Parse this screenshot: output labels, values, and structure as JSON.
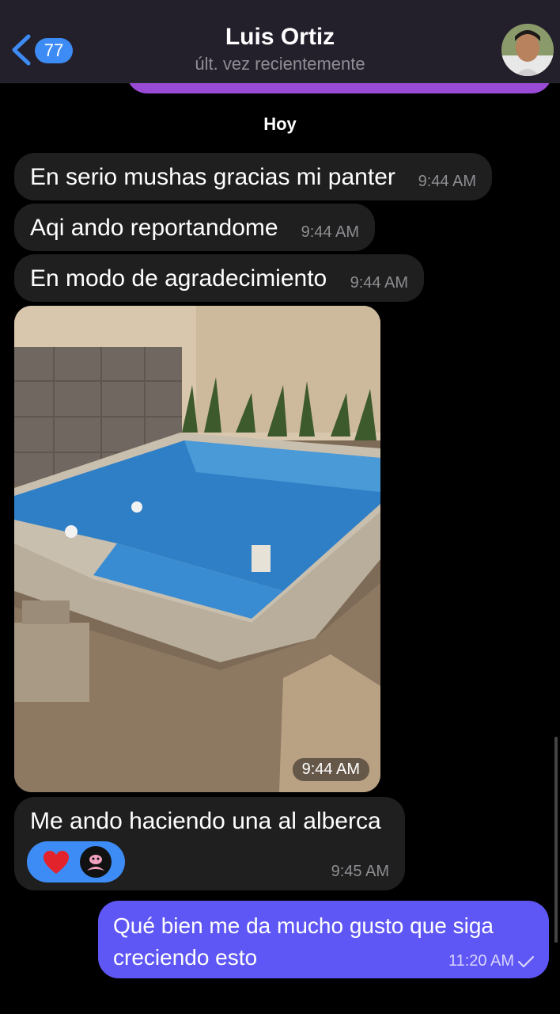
{
  "header": {
    "back_count": "77",
    "contact_name": "Luis Ortiz",
    "status": "últ. vez recientemente"
  },
  "chat": {
    "day_label": "Hoy",
    "messages": [
      {
        "text": "En serio mushas gracias mi panter",
        "time": "9:44 AM"
      },
      {
        "text": "Aqi ando reportandome",
        "time": "9:44 AM"
      },
      {
        "text": "En modo de agradecimiento",
        "time": "9:44 AM"
      },
      {
        "photo_time": "9:44 AM"
      },
      {
        "text": "Me ando haciendo una al alberca",
        "time": "9:45 AM",
        "reactions": [
          "red-heart-icon",
          "pink-panther-sticker-icon"
        ]
      },
      {
        "text": "Qué bien me da mucho gusto que siga creciendo esto",
        "time": "11:20 AM"
      }
    ]
  },
  "colors": {
    "incoming_bubble": "#1f1f1f",
    "outgoing_bubble": "#5f57f5",
    "accent": "#3d8cf5",
    "header_bg": "#231f2b"
  }
}
